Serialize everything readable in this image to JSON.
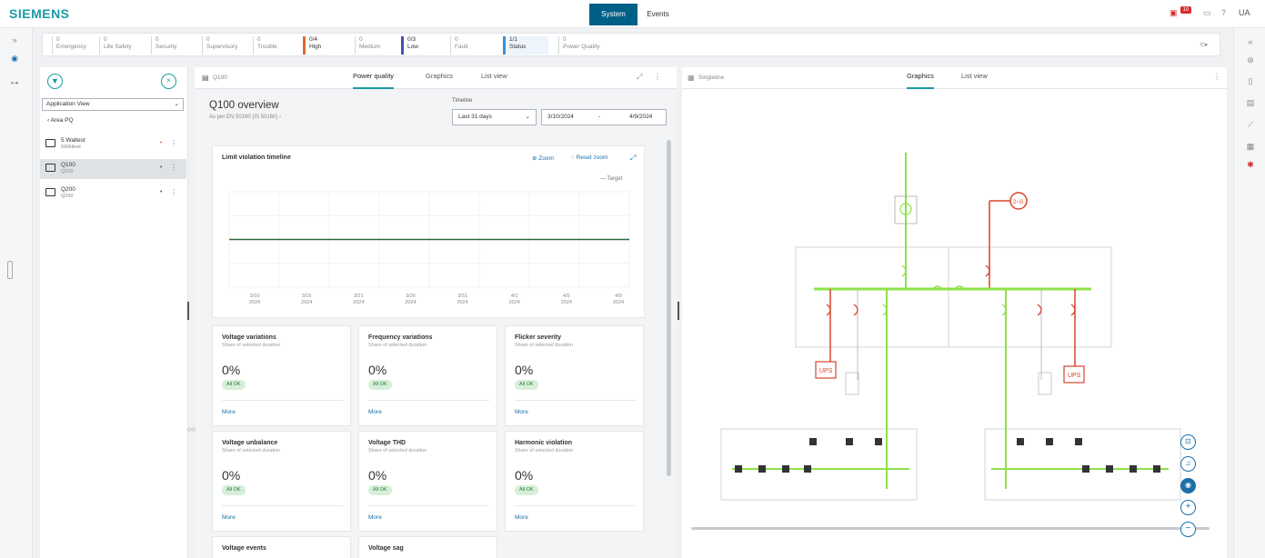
{
  "app": {
    "brand": "SIEMENS",
    "user": "UA",
    "notification_count": "10"
  },
  "topnav": {
    "system": "System",
    "events": "Events"
  },
  "statusbar": {
    "items": [
      {
        "count": "0",
        "label": "Emergency",
        "style": "normal"
      },
      {
        "count": "0",
        "label": "Life Safety",
        "style": "normal"
      },
      {
        "count": "0",
        "label": "Security",
        "style": "normal"
      },
      {
        "count": "0",
        "label": "Supervisory",
        "style": "normal"
      },
      {
        "count": "0",
        "label": "Trouble",
        "style": "normal"
      },
      {
        "count": "0/4",
        "label": "High",
        "style": "hi"
      },
      {
        "count": "0",
        "label": "Medium",
        "style": "normal"
      },
      {
        "count": "0/3",
        "label": "Low",
        "style": "lo"
      },
      {
        "count": "0",
        "label": "Fault",
        "style": "normal"
      },
      {
        "count": "1/1",
        "label": "Status",
        "style": "st"
      },
      {
        "count": "0",
        "label": "Power Quality",
        "style": "normal"
      }
    ],
    "end_icon": "⊂▸"
  },
  "tree": {
    "view_select": "Application View",
    "back_label": "Area PQ",
    "items": [
      {
        "title": "5 Waltest",
        "sub": "5WAltest",
        "dot_color": "#e06a2b",
        "selected": false
      },
      {
        "title": "Q100",
        "sub": "Q100",
        "dot_color": "#555555",
        "selected": true
      },
      {
        "title": "Q200",
        "sub": "Q200",
        "dot_color": "#555555",
        "selected": false
      }
    ]
  },
  "q100": {
    "name": "Q100",
    "tabs": {
      "power_quality": "Power quality",
      "graphics": "Graphics",
      "list_view": "List view"
    },
    "overview_title": "Q100 overview",
    "overview_sub": "As per EN 50160 (IS 50160)",
    "timeline_label": "Timeline",
    "timeline_value": "Last 31 days",
    "date_from": "3/10/2024",
    "date_sep": "-",
    "date_to": "4/9/2024",
    "chart_title": "Limit violation timeline",
    "zoom_label": "Zoom",
    "reset_zoom_label": "Reset zoom",
    "legend_label": "Target",
    "cards": [
      {
        "title": "Voltage variations",
        "sub": "Share of selected duration",
        "value": "0%",
        "badge": "All OK",
        "more": "More"
      },
      {
        "title": "Frequency variations",
        "sub": "Share of selected duration",
        "value": "0%",
        "badge": "All OK",
        "more": "More"
      },
      {
        "title": "Flicker severity",
        "sub": "Share of selected duration",
        "value": "0%",
        "badge": "All OK",
        "more": "More"
      },
      {
        "title": "Voltage unbalance",
        "sub": "Share of selected duration",
        "value": "0%",
        "badge": "All OK",
        "more": "More"
      },
      {
        "title": "Voltage THD",
        "sub": "Share of selected duration",
        "value": "0%",
        "badge": "All OK",
        "more": "More"
      },
      {
        "title": "Harmonic violation",
        "sub": "Share of selected duration",
        "value": "0%",
        "badge": "All OK",
        "more": "More"
      },
      {
        "title": "Voltage events",
        "sub": "",
        "value": "",
        "badge": "",
        "more": ""
      },
      {
        "title": "Voltage sag",
        "sub": "",
        "value": "",
        "badge": "",
        "more": ""
      }
    ]
  },
  "chart_data": {
    "type": "line",
    "title": "Limit violation timeline",
    "x_ticks": [
      "3/10\n2024",
      "3/15\n2024",
      "3/21\n2024",
      "3/26\n2024",
      "3/31\n2024",
      "4/1\n2024",
      "4/5\n2024",
      "4/9\n2024"
    ],
    "series": [
      {
        "name": "Target",
        "color": "#2e6b3a",
        "values": [
          0.5,
          0.5,
          0.5,
          0.5,
          0.5,
          0.5,
          0.5,
          0.5
        ]
      }
    ],
    "ylim": [
      0,
      1
    ],
    "grid": true,
    "legend": "top-right"
  },
  "singleline": {
    "name": "Singleline",
    "tabs": {
      "graphics": "Graphics",
      "list_view": "List view"
    },
    "ups_label": "UPS",
    "gen_label": "2~G",
    "colors": {
      "live": "#8fe04a",
      "fault": "#d9442b",
      "dead": "#b9bcc0"
    }
  }
}
